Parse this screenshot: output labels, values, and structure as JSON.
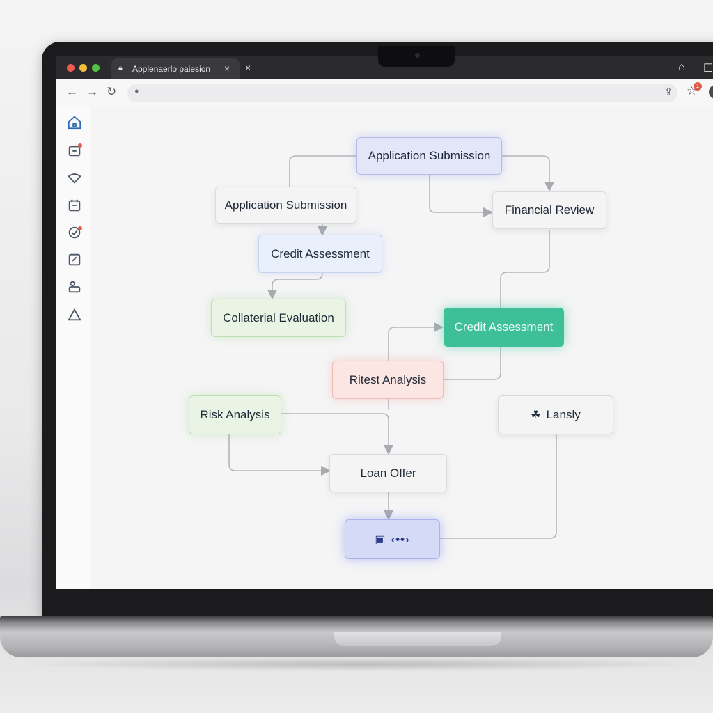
{
  "browser": {
    "tab_title": "Applenaerlo paiesion",
    "tab_close": "×",
    "new_tab_close": "×",
    "notification_count": "1",
    "icons": {
      "lock": "lock-icon",
      "back": "arrow-left-icon",
      "forward": "arrow-right-icon",
      "reload": "reload-icon",
      "home": "home-icon",
      "share": "share-icon",
      "bookmark": "star-icon"
    }
  },
  "sidebar": {
    "items": [
      {
        "icon": "home-icon",
        "active": true
      },
      {
        "icon": "inbox-icon",
        "notification": true
      },
      {
        "icon": "wifi-icon"
      },
      {
        "icon": "calendar-icon"
      },
      {
        "icon": "check-circle-icon",
        "notification": true
      },
      {
        "icon": "checkbox-icon"
      },
      {
        "icon": "users-icon"
      },
      {
        "icon": "warning-icon"
      }
    ]
  },
  "flowchart": {
    "nodes": {
      "application_submission_top": "Application Submission",
      "application_submission_left": "Application Submission",
      "financial_review": "Financial Review",
      "credit_assessment_left": "Credit Assessment",
      "collateral_evaluation": "Collaterial Evaluation",
      "credit_assessment_highlight": "Credit Assessment",
      "ritest_analysis": "Ritest Analysis",
      "risk_analysis": "Risk Analysis",
      "lansly": "Lansly",
      "loan_offer": "Loan Offer",
      "final_node_label": "‹••›"
    },
    "colors": {
      "blue": "#e3e6f7",
      "green": "#e9f4e4",
      "teal": "#3fbf98",
      "red": "#fbe6e4",
      "gray": "#f4f4f5",
      "connector": "#a9abb1"
    }
  }
}
